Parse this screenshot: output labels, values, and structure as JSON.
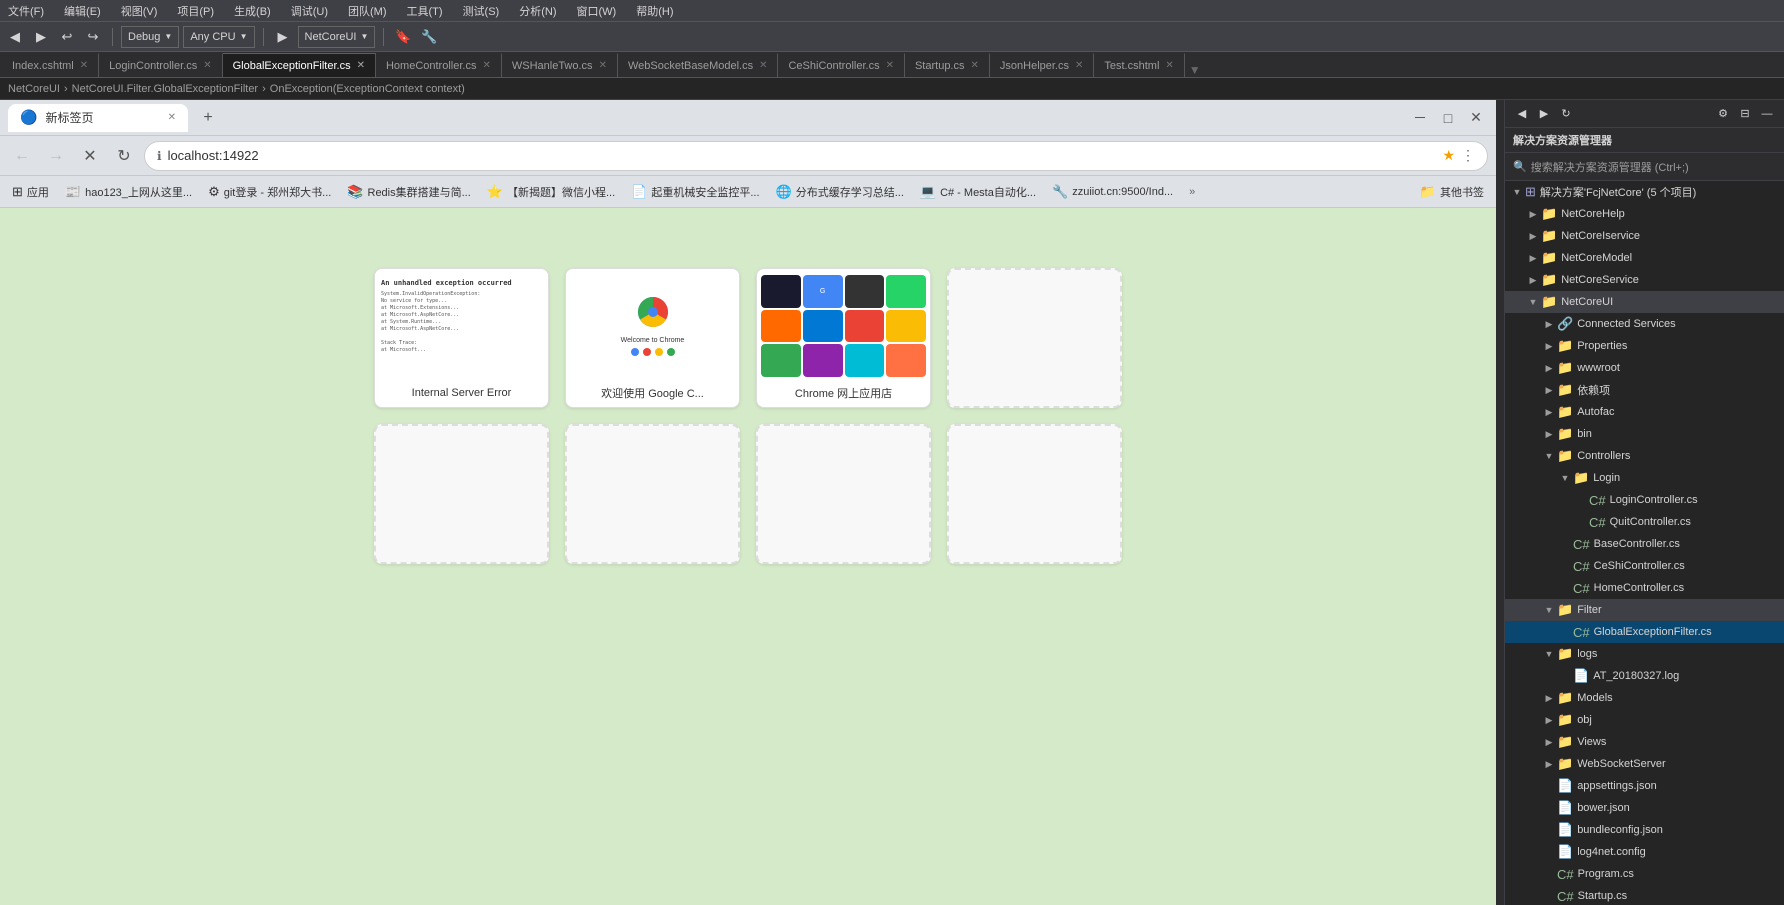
{
  "titlebar": {
    "menus": [
      "文件(F)",
      "编辑(E)",
      "视图(V)",
      "项目(P)",
      "生成(B)",
      "调试(U)",
      "团队(M)",
      "工具(T)",
      "测试(S)",
      "分析(N)",
      "窗口(W)",
      "帮助(H)"
    ]
  },
  "toolbar": {
    "config": "Debug",
    "platform": "Any CPU",
    "project": "NetCoreUI",
    "buttons": [
      "◀",
      "▶",
      "⏸",
      "⏹"
    ]
  },
  "tabs": [
    {
      "label": "Index.cshtml",
      "active": false,
      "modified": false
    },
    {
      "label": "LoginController.cs",
      "active": false,
      "modified": false
    },
    {
      "label": "GlobalExceptionFilter.cs",
      "active": true,
      "modified": false
    },
    {
      "label": "HomeController.cs",
      "active": false,
      "modified": false
    },
    {
      "label": "WSHanleTwo.cs",
      "active": false,
      "modified": false
    },
    {
      "label": "WebSocketBaseModel.cs",
      "active": false,
      "modified": false
    },
    {
      "label": "CeShiController.cs",
      "active": false,
      "modified": false
    },
    {
      "label": "Startup.cs",
      "active": false,
      "modified": false
    },
    {
      "label": "JsonHelper.cs",
      "active": false,
      "modified": false
    },
    {
      "label": "Test.cshtml",
      "active": false,
      "modified": false
    }
  ],
  "pathbar": {
    "project": "NetCoreUI",
    "filter_namespace": "NetCoreUI.Filter.GlobalExceptionFilter",
    "method": "OnException(ExceptionContext context)"
  },
  "chrome": {
    "tab_label": "新标签页",
    "address": "localhost:14922",
    "window_controls": [
      "－",
      "□",
      "✕"
    ],
    "nav_buttons": [
      "←",
      "→",
      "✕",
      "↻"
    ],
    "bookmarks": [
      {
        "icon": "🔵",
        "label": "应用"
      },
      {
        "icon": "📰",
        "label": "hao123_上网从这里..."
      },
      {
        "icon": "🔧",
        "label": "git登录 - 郑州郑大书..."
      },
      {
        "icon": "📚",
        "label": "Redis集群搭建与简..."
      },
      {
        "icon": "⭐",
        "label": "【新揭题】微信小程..."
      },
      {
        "icon": "📄",
        "label": "起重机械安全监控平..."
      },
      {
        "icon": "🌐",
        "label": "分布式缓存学习总结..."
      },
      {
        "icon": "💻",
        "label": "C# - Mesta自动化..."
      },
      {
        "icon": "🔧",
        "label": "zzuiiot.cn:9500/Ind..."
      },
      {
        "icon": "📁",
        "label": "其他书签"
      }
    ],
    "thumbnails": [
      {
        "label": "Internal Server Error",
        "type": "error",
        "has_content": true
      },
      {
        "label": "欢迎使用 Google C...",
        "type": "welcome",
        "has_content": true
      },
      {
        "label": "Chrome 网上应用店",
        "type": "appstore",
        "has_content": true
      },
      {
        "label": "",
        "type": "empty",
        "has_content": false
      },
      {
        "label": "",
        "type": "empty",
        "has_content": false
      },
      {
        "label": "",
        "type": "empty",
        "has_content": false
      },
      {
        "label": "",
        "type": "empty",
        "has_content": false
      },
      {
        "label": "",
        "type": "empty",
        "has_content": false
      }
    ],
    "error_preview_text": "An unhandled exception occurred while processing the request.\nSystem.InvalidOperationException: No service for type ...\n  at Microsoft.Extensions.DependencyInjection...\n  at Microsoft.AspNetCore.Mvc...",
    "welcome_title": "Welcome to Chrome"
  },
  "solution_explorer": {
    "title": "解决方案资源管理器",
    "search_placeholder": "搜索解决方案资源管理器 (Ctrl+;)",
    "solution": {
      "label": "解决方案'FcjNetCore' (5 个项目)",
      "projects": [
        {
          "name": "NetCoreHelp",
          "type": "project",
          "expanded": false
        },
        {
          "name": "NetCoreIservice",
          "type": "project",
          "expanded": false
        },
        {
          "name": "NetCoreModel",
          "type": "project",
          "expanded": false
        },
        {
          "name": "NetCoreService",
          "type": "project",
          "expanded": false
        },
        {
          "name": "NetCoreUI",
          "type": "project",
          "expanded": true,
          "children": [
            {
              "name": "Connected Services",
              "type": "folder",
              "expanded": false,
              "indent": 1
            },
            {
              "name": "Properties",
              "type": "folder",
              "expanded": false,
              "indent": 1
            },
            {
              "name": "wwwroot",
              "type": "folder",
              "expanded": false,
              "indent": 1
            },
            {
              "name": "依赖项",
              "type": "folder",
              "expanded": false,
              "indent": 1
            },
            {
              "name": "Autofac",
              "type": "folder",
              "expanded": false,
              "indent": 1
            },
            {
              "name": "bin",
              "type": "folder",
              "expanded": false,
              "indent": 1
            },
            {
              "name": "Controllers",
              "type": "folder",
              "expanded": true,
              "indent": 1,
              "children": [
                {
                  "name": "Login",
                  "type": "folder",
                  "expanded": true,
                  "indent": 2,
                  "children": [
                    {
                      "name": "LoginController.cs",
                      "type": "cs",
                      "indent": 3
                    },
                    {
                      "name": "QuitController.cs",
                      "type": "cs",
                      "indent": 3
                    }
                  ]
                },
                {
                  "name": "BaseController.cs",
                  "type": "cs",
                  "indent": 2
                },
                {
                  "name": "CeShiController.cs",
                  "type": "cs",
                  "indent": 2
                },
                {
                  "name": "HomeController.cs",
                  "type": "cs",
                  "indent": 2
                }
              ]
            },
            {
              "name": "Filter",
              "type": "folder",
              "expanded": true,
              "indent": 1,
              "children": [
                {
                  "name": "GlobalExceptionFilter.cs",
                  "type": "cs",
                  "indent": 2,
                  "selected": true
                }
              ]
            },
            {
              "name": "logs",
              "type": "folder",
              "expanded": true,
              "indent": 1,
              "children": [
                {
                  "name": "AT_20180327.log",
                  "type": "file",
                  "indent": 2
                }
              ]
            },
            {
              "name": "Models",
              "type": "folder",
              "expanded": false,
              "indent": 1
            },
            {
              "name": "obj",
              "type": "folder",
              "expanded": false,
              "indent": 1
            },
            {
              "name": "Views",
              "type": "folder",
              "expanded": false,
              "indent": 1
            },
            {
              "name": "WebSocketServer",
              "type": "folder",
              "expanded": false,
              "indent": 1
            },
            {
              "name": "appsettings.json",
              "type": "file",
              "indent": 1
            },
            {
              "name": "bower.json",
              "type": "file",
              "indent": 1
            },
            {
              "name": "bundleconfig.json",
              "type": "file",
              "indent": 1
            },
            {
              "name": "log4net.config",
              "type": "file",
              "indent": 1
            },
            {
              "name": "Program.cs",
              "type": "cs",
              "indent": 1
            },
            {
              "name": "Startup.cs",
              "type": "cs",
              "indent": 1
            }
          ]
        }
      ]
    }
  },
  "app_icons": [
    {
      "color": "#4285F4"
    },
    {
      "color": "#EA4335"
    },
    {
      "color": "#FBBC05"
    },
    {
      "color": "#34A853"
    },
    {
      "color": "#8E24AA"
    },
    {
      "color": "#00BCD4"
    },
    {
      "color": "#FF7043"
    },
    {
      "color": "#7CB342"
    },
    {
      "color": "#546E7A"
    },
    {
      "color": "#E91E63"
    },
    {
      "color": "#3949AB"
    },
    {
      "color": "#00897B"
    }
  ]
}
